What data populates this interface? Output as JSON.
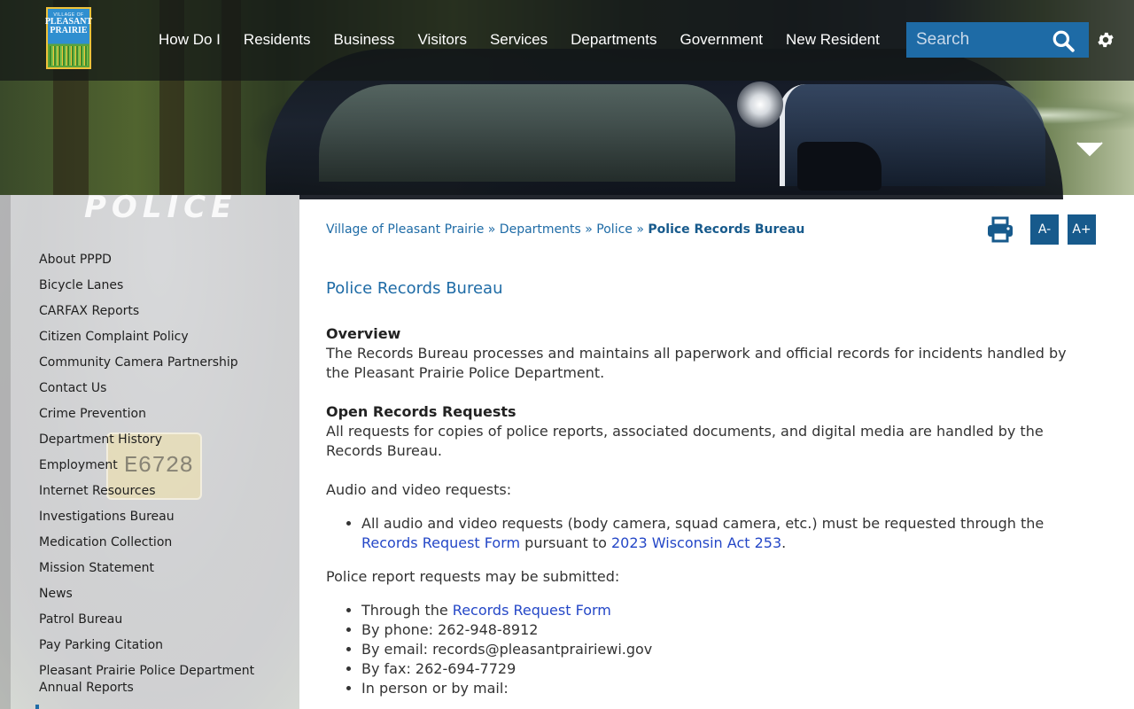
{
  "brand": {
    "logo_top": "VILLAGE OF",
    "logo_line1": "PLEASANT",
    "logo_line2": "PRAIRIE"
  },
  "nav": {
    "items": [
      "How Do I",
      "Residents",
      "Business",
      "Visitors",
      "Services",
      "Departments",
      "Government",
      "New Resident"
    ]
  },
  "search": {
    "placeholder": "Search"
  },
  "hero": {
    "ghost_text": "POLICE",
    "plate_text": "E6728"
  },
  "sidebar": {
    "items": [
      "About PPPD",
      "Bicycle Lanes",
      "CARFAX Reports",
      "Citizen Complaint Policy",
      "Community Camera Partnership",
      "Contact Us",
      "Crime Prevention",
      "Department History",
      "Employment",
      "Internet Resources",
      "Investigations Bureau",
      "Medication Collection",
      "Mission Statement",
      "News",
      "Patrol Bureau",
      "Pay Parking Citation",
      "Pleasant Prairie Police Department Annual Reports"
    ]
  },
  "breadcrumb": {
    "crumb1": "Village of Pleasant Prairie",
    "crumb2": "Departments",
    "crumb3": "Police",
    "current": "Police Records Bureau",
    "sep": "»"
  },
  "tools": {
    "font_decrease": "A-",
    "font_increase": "A+"
  },
  "page": {
    "title": "Police Records Bureau",
    "overview_heading": "Overview",
    "overview_text": "The Records Bureau processes and maintains all paperwork and official records for incidents handled by the Pleasant Prairie Police Department.",
    "open_records_heading": "Open Records Requests",
    "open_records_text": "All requests for copies of police reports, associated documents, and digital media are handled by the Records Bureau.",
    "av_intro": "Audio and video requests:",
    "av_item_prefix": "All audio and video requests (body camera, squad camera, etc.) must be requested through the ",
    "av_item_link1": "Records Request Form",
    "av_item_mid": " pursuant to ",
    "av_item_link2": "2023 Wisconsin Act 253",
    "av_item_suffix": ".",
    "report_intro": "Police report requests may be submitted:",
    "report_item1_prefix": "Through the ",
    "report_item1_link": "Records Request Form",
    "report_item2": "By phone: 262-948-8912",
    "report_item3": "By email: records@pleasantprairiewi.gov",
    "report_item4": "By fax: 262-694-7729",
    "report_item5": "In person or by mail:"
  },
  "colors": {
    "brand_blue": "#1e6ba6",
    "dark_blue": "#175a8c",
    "link_blue": "#2447c7"
  }
}
